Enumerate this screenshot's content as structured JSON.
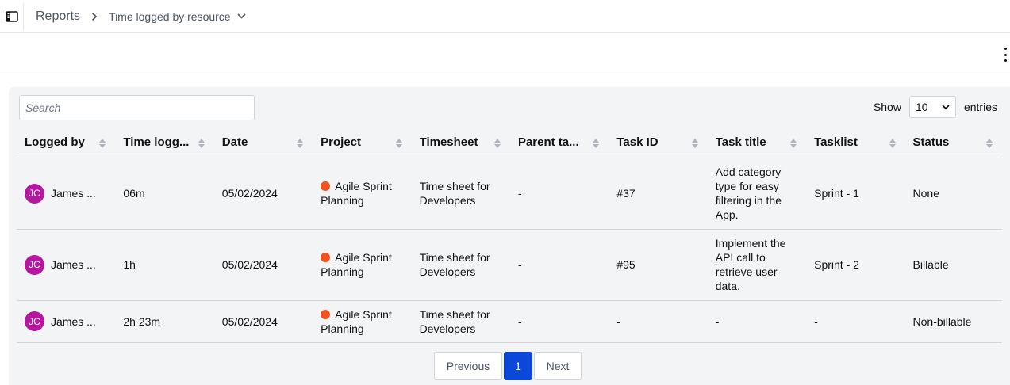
{
  "breadcrumb": {
    "root": "Reports",
    "current": "Time logged by resource"
  },
  "search": {
    "placeholder": "Search"
  },
  "entries": {
    "show_label": "Show",
    "value": "10",
    "suffix": "entries"
  },
  "columns": [
    "Logged by",
    "Time logg...",
    "Date",
    "Project",
    "Timesheet",
    "Parent ta...",
    "Task ID",
    "Task title",
    "Tasklist",
    "Status"
  ],
  "rows": [
    {
      "initials": "JC",
      "logged_by": "James ...",
      "time": "06m",
      "date": "05/02/2024",
      "project": "Agile Sprint Planning",
      "timesheet": "Time sheet for Developers",
      "parent": "-",
      "task_id": "#37",
      "task_title": "Add category type for easy filtering in the App.",
      "tasklist": "Sprint - 1",
      "status": "None"
    },
    {
      "initials": "JC",
      "logged_by": "James ...",
      "time": "1h",
      "date": "05/02/2024",
      "project": "Agile Sprint Planning",
      "timesheet": "Time sheet for Developers",
      "parent": "-",
      "task_id": "#95",
      "task_title": "Implement the API call to retrieve user data.",
      "tasklist": "Sprint - 2",
      "status": "Billable"
    },
    {
      "initials": "JC",
      "logged_by": "James ...",
      "time": "2h 23m",
      "date": "05/02/2024",
      "project": "Agile Sprint Planning",
      "timesheet": "Time sheet for Developers",
      "parent": "-",
      "task_id": "-",
      "task_title": "-",
      "tasklist": "-",
      "status": "Non-billable"
    }
  ],
  "pagination": {
    "previous": "Previous",
    "current": "1",
    "next": "Next"
  },
  "colors": {
    "accent": "#0b47d8",
    "avatar": "#b5179e",
    "project_dot": "#f4511e"
  },
  "icons": {
    "sidebar": "sidebar-toggle-icon",
    "chevron": "chevron-right-icon",
    "dropdown": "chevron-down-icon",
    "more": "kebab-menu-icon",
    "sort": "sort-icon"
  }
}
